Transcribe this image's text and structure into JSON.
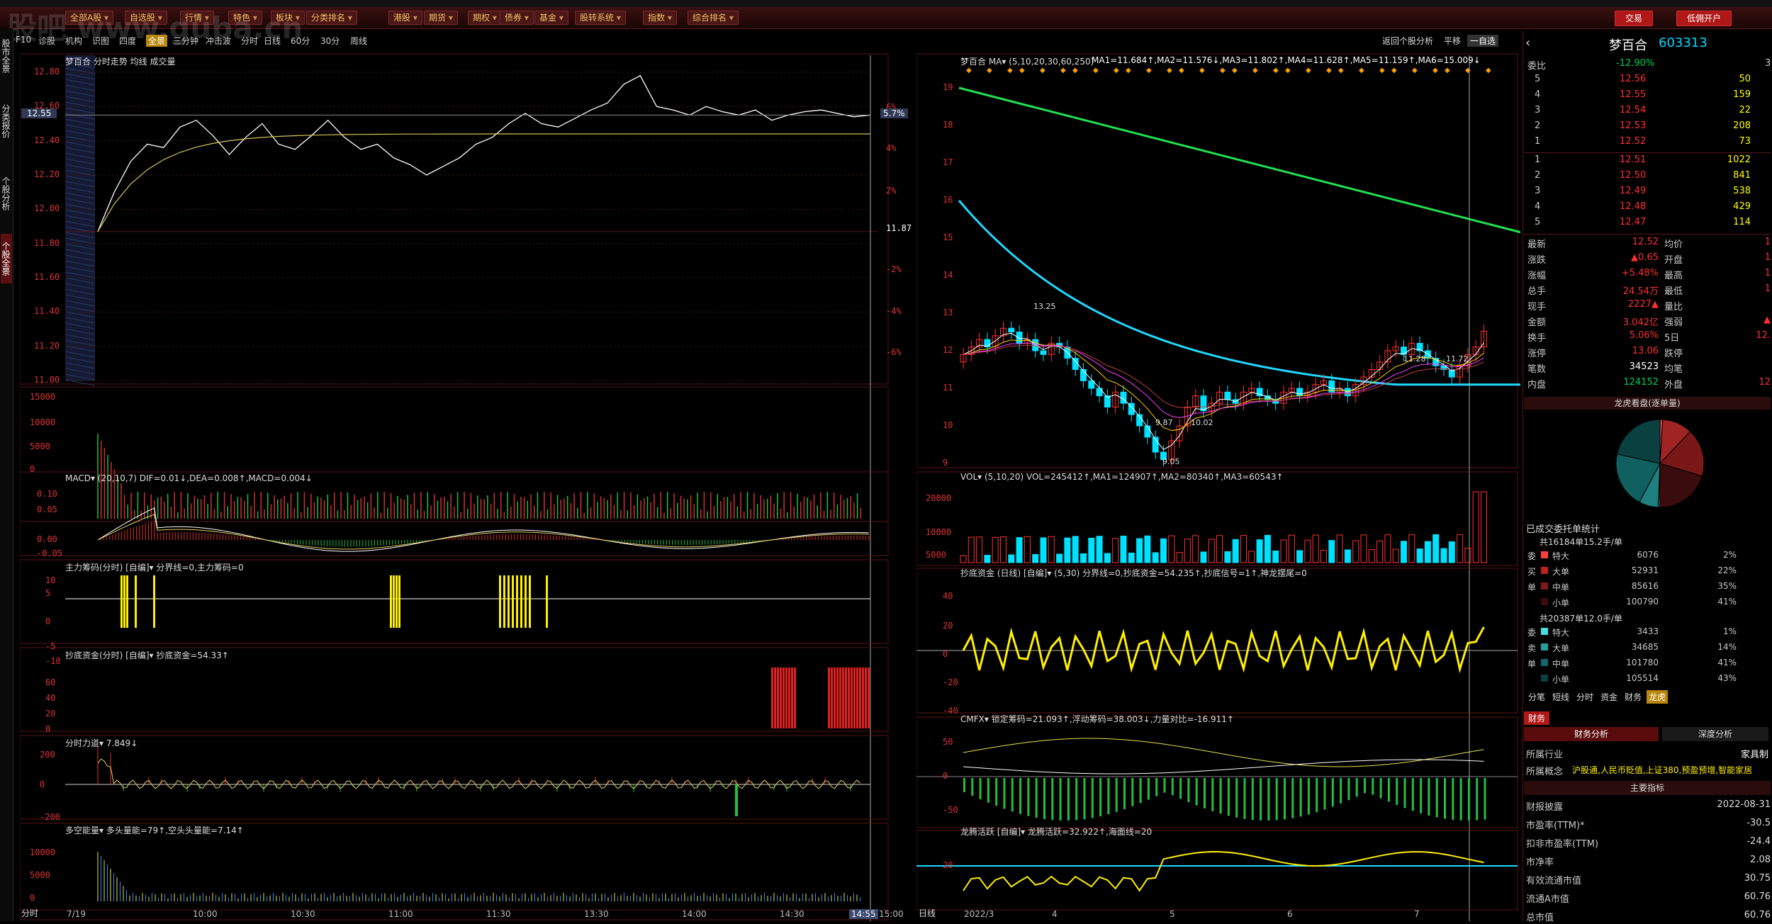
{
  "menu": {
    "items": [
      "全部A股",
      "自选股",
      "行情",
      "特色",
      "板块",
      "分类排名",
      "港股",
      "期货",
      "期权",
      "债券",
      "基金",
      "股转系统",
      "指数",
      "综合排名"
    ],
    "trade_btn": "交易",
    "open_btn": "低佣开户",
    "watermark": "股吧 www.guba.cn"
  },
  "toolbar": {
    "items": [
      "F10",
      "诊股",
      "机构",
      "识图",
      "四度",
      "全景",
      "三分钟",
      "冲击波",
      "分时",
      "日线",
      "60分",
      "30分",
      "周线"
    ],
    "active": "全景",
    "return_btn": "返回个股分析",
    "flat": "平移",
    "selected": "一自选"
  },
  "left_tabs": [
    "股市全景",
    "分类报价",
    "个股分析",
    "个股全景"
  ],
  "intraday": {
    "title": "梦百合  分时走势 均线 成交量",
    "price_ticks": [
      "12.80",
      "12.60",
      "12.40",
      "12.20",
      "12.00",
      "11.80",
      "11.60",
      "11.40",
      "11.20",
      "11.00"
    ],
    "pct_ticks": [
      "6%",
      "4%",
      "2%",
      "11.87",
      "-2%",
      "-4%",
      "-6%"
    ],
    "current_price": "12.55",
    "current_pct": "5.7%",
    "prev_close": 11.87,
    "vol_ticks": [
      "15000",
      "10000",
      "5000",
      "0"
    ],
    "macd_title": "MACD▾ (20,10,7)  DIF=0.01↓,DEA=0.008↑,MACD=0.004↓",
    "macd_ticks": [
      "0.10",
      "0.05",
      "0.00",
      "-0.05"
    ],
    "zhuli_title": "主力筹码(分时) [自编]▾  分界线=0,主力筹码=0",
    "zhuli_ticks": [
      "10",
      "5",
      "0",
      "-5",
      "-10"
    ],
    "chaodi_title": "抄底资金(分时) [自编]▾ 抄底资金=54.33↑",
    "chaodi_ticks": [
      "60",
      "40",
      "20",
      "0"
    ],
    "lidao_title": "分时力道▾  7.849↓",
    "lidao_ticks": [
      "200",
      "0",
      "-200"
    ],
    "duokong_title": "多空能量▾  多头量能=79↑,空头头量能=7.14↑",
    "duokong_ticks": [
      "10000",
      "5000",
      "0"
    ],
    "time_labels": [
      "7/19",
      "10:00",
      "10:30",
      "11:00",
      "11:30",
      "13:30",
      "14:00",
      "14:30",
      "14:55",
      "15:00"
    ],
    "time_mode": "分时"
  },
  "daily": {
    "title": "梦百合  MA▾ (5,10,20,30,60,250)",
    "ma_values": [
      "MA1=11.684↑",
      "MA2=11.576↓",
      "MA3=11.802↑",
      "MA4=11.628↑",
      "MA5=11.159↑",
      "MA6=15.009↓"
    ],
    "price_ticks": [
      "19",
      "18",
      "17",
      "16",
      "15",
      "14",
      "13",
      "12",
      "11",
      "10",
      "9"
    ],
    "annotations": [
      "13.25",
      "9.05",
      "9.87",
      "10.02",
      "11.28",
      "11.72"
    ],
    "vol_title": "VOL▾  (5,10,20)  VOL=245412↑,MA1=124907↑,MA2=80340↑,MA3=60543↑",
    "vol_ticks": [
      "20000",
      "10000",
      "5000"
    ],
    "chaodi_title": "抄底资金 (日线) [自编]▾  (5,30) 分界线=0,抄底资金=54.235↑,抄底信号=1↑,神龙摆尾=0",
    "chaodi_ticks": [
      "40",
      "20",
      "0",
      "-20",
      "-40"
    ],
    "cmfx_title": "CMFX▾  锁定筹码=21.093↑,浮动筹码=38.003↓,力量对比=-16.911↑",
    "cmfx_ticks": [
      "50",
      "0",
      "-50"
    ],
    "longteng_title": "龙腾活跃 [自编]▾  龙腾活跃=32.922↑,海面线=20",
    "longteng_ticks": [
      "20"
    ],
    "date_labels": [
      "2022/3",
      "4",
      "5",
      "6",
      "7"
    ],
    "date_mode": "日线"
  },
  "quote": {
    "name": "梦百合",
    "code": "603313",
    "weibi_label": "委比",
    "weibi": "-12.90%",
    "weicha": "3",
    "asks": [
      [
        "5",
        "12.56",
        "50"
      ],
      [
        "4",
        "12.55",
        "159"
      ],
      [
        "3",
        "12.54",
        "22"
      ],
      [
        "2",
        "12.53",
        "208"
      ],
      [
        "1",
        "12.52",
        "73"
      ]
    ],
    "bids": [
      [
        "1",
        "12.51",
        "1022"
      ],
      [
        "2",
        "12.50",
        "841"
      ],
      [
        "3",
        "12.49",
        "538"
      ],
      [
        "4",
        "12.48",
        "429"
      ],
      [
        "5",
        "12.47",
        "114"
      ]
    ],
    "stats": [
      [
        "最新",
        "12.52",
        "均价",
        "1"
      ],
      [
        "涨跌",
        "▲0.65",
        "开盘",
        "1"
      ],
      [
        "涨幅",
        "+5.48%",
        "最高",
        "1"
      ],
      [
        "总手",
        "24.54万",
        "最低",
        "1"
      ],
      [
        "现手",
        "2227▲",
        "量比",
        ""
      ],
      [
        "金额",
        "3.042亿",
        "强弱",
        "▲"
      ],
      [
        "换手",
        "5.06%",
        "5日",
        "12."
      ],
      [
        "涨停",
        "13.06",
        "跌停",
        ""
      ],
      [
        "笔数",
        "34523",
        "均笔",
        ""
      ],
      [
        "内盘",
        "124152",
        "外盘",
        "12"
      ]
    ],
    "pie_title": "龙虎看盘(逐单量)",
    "filled_title": "已成交委托单统计",
    "sell_header": "共16184单15.2手/单",
    "sell_rows": [
      [
        "特大",
        "6076",
        "2%"
      ],
      [
        "大单",
        "52931",
        "22%"
      ],
      [
        "中单",
        "85616",
        "35%"
      ],
      [
        "小单",
        "100790",
        "41%"
      ]
    ],
    "sell_side": [
      "委",
      "买",
      "单"
    ],
    "buy_header": "共20387单12.0手/单",
    "buy_rows": [
      [
        "特大",
        "3433",
        "1%"
      ],
      [
        "大单",
        "34685",
        "14%"
      ],
      [
        "中单",
        "101780",
        "41%"
      ],
      [
        "小单",
        "105514",
        "43%"
      ]
    ],
    "buy_side": [
      "委",
      "卖",
      "单"
    ],
    "tabs": [
      "分笔",
      "短线",
      "分时",
      "资金",
      "财务",
      "龙虎"
    ],
    "active_tab": "龙虎",
    "fin_tab": "财务",
    "fin_sub": [
      "财务分析",
      "深度分析"
    ],
    "industry_label": "所属行业",
    "industry": "家具制",
    "concept_label": "所属概念",
    "concept": "沪股通,人民币贬值,上证380,预盈预增,智能家居",
    "main_idx": "主要指标",
    "fin_rows": [
      [
        "财报披露",
        "2022-08-31"
      ],
      [
        "市盈率(TTM)*",
        "-30.5"
      ],
      [
        "扣非市盈率(TTM)",
        "-24.4"
      ],
      [
        "市净率",
        "2.08"
      ],
      [
        "有效流通市值",
        "30.75"
      ],
      [
        "流通A市值",
        "60.76"
      ],
      [
        "总市值",
        "60.76"
      ]
    ]
  },
  "colors": {
    "up": "#ff3030",
    "down": "#00d050",
    "bg": "#000000",
    "grid": "#5a1414"
  }
}
